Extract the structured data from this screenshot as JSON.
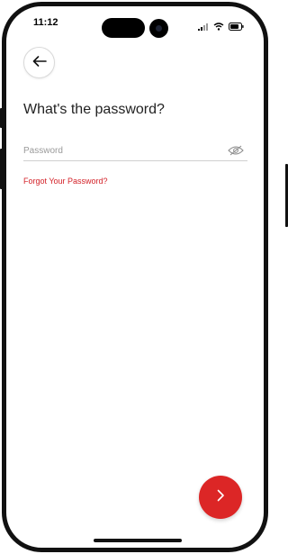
{
  "status_bar": {
    "time": "11:12",
    "icons": [
      "signal-icon",
      "wifi-icon",
      "battery-icon"
    ]
  },
  "header": {
    "back_icon": "arrow-left-icon"
  },
  "main": {
    "title": "What's the password?",
    "password_field": {
      "placeholder": "Password",
      "value": "",
      "toggle_icon": "eye-slash-icon"
    },
    "forgot_link": "Forgot Your Password?"
  },
  "footer": {
    "next_icon": "chevron-right-icon",
    "accent_color": "#dc2626"
  }
}
